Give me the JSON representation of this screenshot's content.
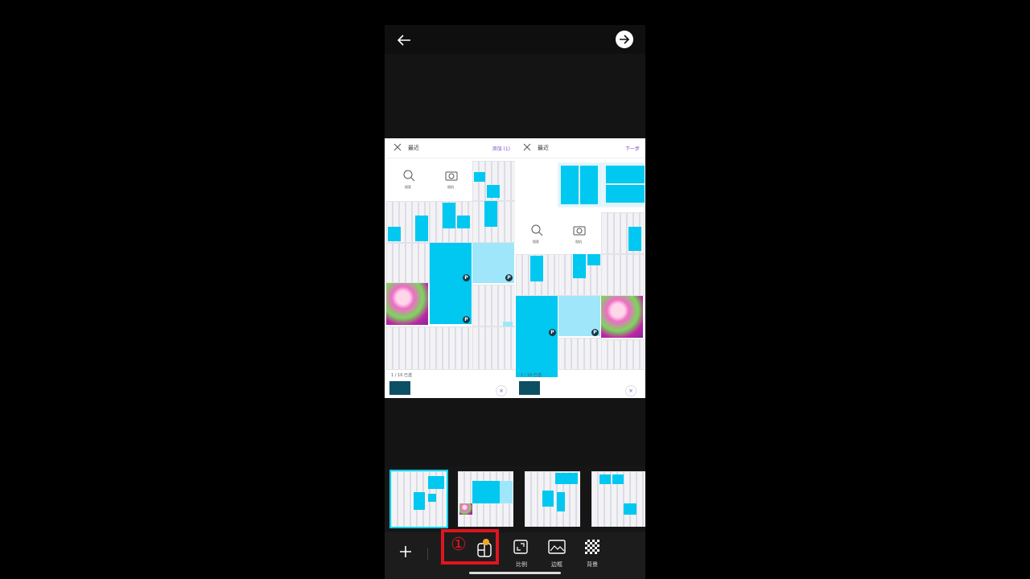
{
  "panels": {
    "left": {
      "title": "最近",
      "action": "添加 (1)",
      "search_label": "搜索",
      "camera_label": "相机",
      "selected_count": "1 / 10 已选",
      "badge": "P",
      "clear_mark": "×"
    },
    "right": {
      "title": "最近",
      "action": "下一步",
      "search_label": "搜索",
      "camera_label": "相机",
      "selected_count": "1 / 10 已选",
      "badge": "P",
      "clear_mark": "×"
    }
  },
  "toolbar": {
    "ratio_label": "比例",
    "border_label": "边框",
    "background_label": "背景",
    "step_marker": "①"
  },
  "icons": {
    "back": "arrow-left-icon",
    "next": "arrow-right-circle-icon",
    "add": "plus-icon",
    "layout": "layout-grid-icon",
    "ratio": "aspect-ratio-icon",
    "border": "border-icon",
    "background": "checkerboard-icon"
  },
  "colors": {
    "accent": "#00c8f0",
    "highlight": "#e0141e",
    "brand_text": "#7b4ec8",
    "notification_dot": "#f5a623"
  }
}
